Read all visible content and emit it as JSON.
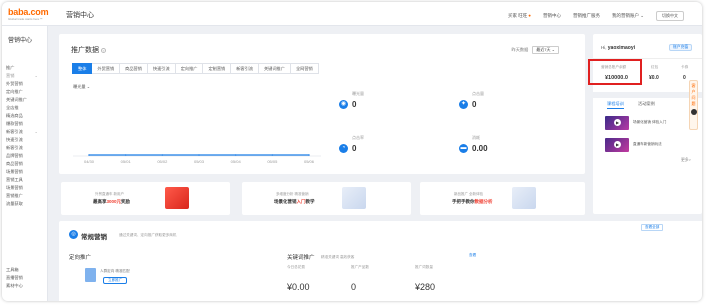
{
  "header": {
    "logo": "baba.com",
    "logo_tagline": "Global trade starts here™",
    "app_title": "营销中心",
    "nav": [
      "买家 旺旺",
      "营销中心",
      "营销推广服务",
      "我的营销账户"
    ],
    "switch_label": "切换中文"
  },
  "sidebar": {
    "home": "营销中心",
    "items": [
      {
        "label": "推广",
        "arrow": ""
      },
      {
        "label": "营销",
        "arrow": "⌄",
        "group": true
      },
      {
        "label": "外贸营销",
        "arrow": ""
      },
      {
        "label": "定向推广",
        "arrow": ""
      },
      {
        "label": "关键词推广",
        "arrow": ""
      },
      {
        "label": "全店推",
        "arrow": ""
      },
      {
        "label": "精选商品",
        "arrow": ""
      },
      {
        "label": "爆款营销",
        "arrow": ""
      },
      {
        "label": "新客引流",
        "arrow": "⌄"
      },
      {
        "label": "快速引流",
        "arrow": ""
      },
      {
        "label": "新客引流",
        "arrow": ""
      },
      {
        "label": "品牌营销",
        "arrow": ""
      },
      {
        "label": "商品营销",
        "arrow": ""
      },
      {
        "label": "场景营销",
        "arrow": ""
      },
      {
        "label": "营销工具",
        "arrow": ""
      },
      {
        "label": "场景营销",
        "arrow": ""
      },
      {
        "label": "营销推广",
        "arrow": ""
      },
      {
        "label": "流量获取",
        "arrow": ""
      }
    ],
    "bottom_items": [
      "工具箱",
      "直播营销",
      "素材中心"
    ]
  },
  "promo": {
    "title": "推广数据",
    "range_label": "昨天数据",
    "range_value": "最近7天",
    "tabs": [
      "整体",
      "外贸营销",
      "商品营销",
      "快速引流",
      "定向推广",
      "定制营销",
      "新客引流",
      "关键词推广",
      "全网营销"
    ],
    "metric_select": "曝光量",
    "kpis": [
      {
        "label": "曝光量",
        "value": "0",
        "icon": "eye-icon",
        "color": "#1a7ee8"
      },
      {
        "label": "点击量",
        "value": "0",
        "icon": "click-icon",
        "color": "#1a7ee8"
      },
      {
        "label": "点击率",
        "value": "0",
        "icon": "cursor-icon",
        "color": "#1a7ee8"
      },
      {
        "label": "消耗",
        "value": "0.00",
        "icon": "wallet-icon",
        "color": "#1a7ee8"
      }
    ]
  },
  "chart_data": {
    "type": "line",
    "categories": [
      "04/30",
      "05/01",
      "05/02",
      "05/03",
      "05/04",
      "05/05",
      "05/06"
    ],
    "series": [
      {
        "values": [
          0,
          0,
          0,
          0,
          0,
          0,
          0
        ]
      }
    ],
    "xlabel": "",
    "ylabel": "",
    "grid": false,
    "color": "#1a7ee8"
  },
  "banners": [
    {
      "line1": "外贸直通车 新用户",
      "line2_pre": "最高享",
      "line2_hl": "3000元",
      "line2_post": "奖励"
    },
    {
      "line1": "多维度分析 精准营销",
      "line2_pre": "场景化营销",
      "line2_hl": "入门",
      "line2_post": "教学"
    },
    {
      "line1": "新品推广 全新体验",
      "line2_pre": "手把手教你",
      "line2_hl": "数据分析",
      "line2_post": ""
    }
  ],
  "account": {
    "greeting": "Hi,",
    "username": "yaoximaoyi",
    "badge": "账户充值",
    "balance_label": "营销总账户余额",
    "balance": "¥10000.0",
    "coupon_label": "红包",
    "coupon": "¥0.0",
    "card_label": "卡券",
    "card": "0",
    "tabs": [
      "课程培训",
      "活动案例"
    ],
    "courses": [
      {
        "title": "场景化营销 体验入门"
      },
      {
        "title": "直通车新营销玩法"
      }
    ],
    "more": "更多>",
    "side_strip": "客户问题"
  },
  "bottom": {
    "title": "常规营销",
    "subtitle": "通过关键词、定向推广获取更多商机",
    "link": "查看全部",
    "direct": {
      "title": "定向推广",
      "desc": "人群定向 精准匹配",
      "button": "立即推广"
    },
    "keyword": {
      "title": "关键词推广",
      "subtitle": "精准关键词 高效获客",
      "link": "查看",
      "stats": [
        {
          "label": "今日总花费",
          "value": "¥0.00"
        },
        {
          "label": "推广产品数",
          "value": "0"
        },
        {
          "label": "推广词数量",
          "value": "¥280"
        }
      ]
    }
  }
}
